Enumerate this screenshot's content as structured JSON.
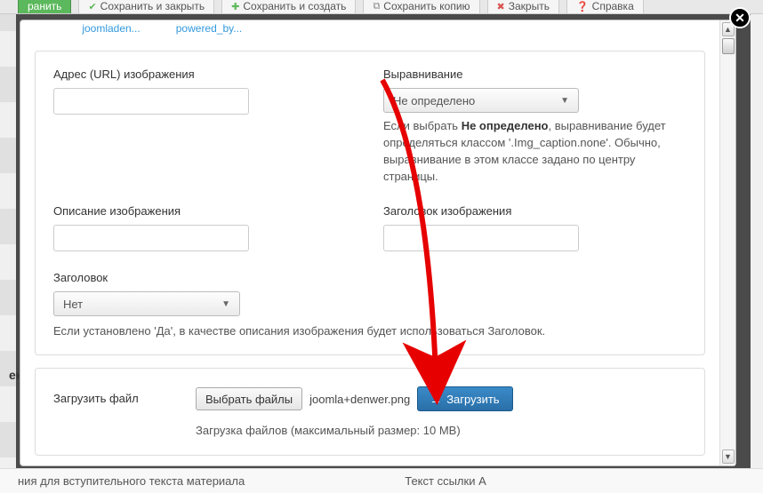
{
  "bg": {
    "toolbar": {
      "apply": "ранить",
      "save_close": "Сохранить и закрыть",
      "save_new": "Сохранить и создать",
      "save_copy": "Сохранить копию",
      "close": "Закрыть",
      "help": "Справка"
    },
    "side_label": "ен",
    "bottom_left": "ния для вступительного текста материала",
    "bottom_right": "Текст ссылки A"
  },
  "thumbs": {
    "a": "joomladen...",
    "b": "powered_by..."
  },
  "form": {
    "url_label": "Адрес (URL) изображения",
    "align_label": "Выравнивание",
    "align_value": "Не определено",
    "align_help_pre": "Если выбрать ",
    "align_help_strong": "Не определено",
    "align_help_post": ", выравнивание будет определяться классом '.Img_caption.none'. Обычно, выравнивание в этом классе задано по центру страницы.",
    "desc_label": "Описание изображения",
    "title_label": "Заголовок изображения",
    "caption_label": "Заголовок",
    "caption_value": "Нет",
    "caption_help": "Если установлено 'Да', в качестве описания изображения будет использоваться Заголовок."
  },
  "upload": {
    "label": "Загрузить файл",
    "choose": "Выбрать файлы",
    "filename": "joomla+denwer.png",
    "button": "Загрузить",
    "hint": "Загрузка файлов (максимальный размер: 10 MB)"
  }
}
